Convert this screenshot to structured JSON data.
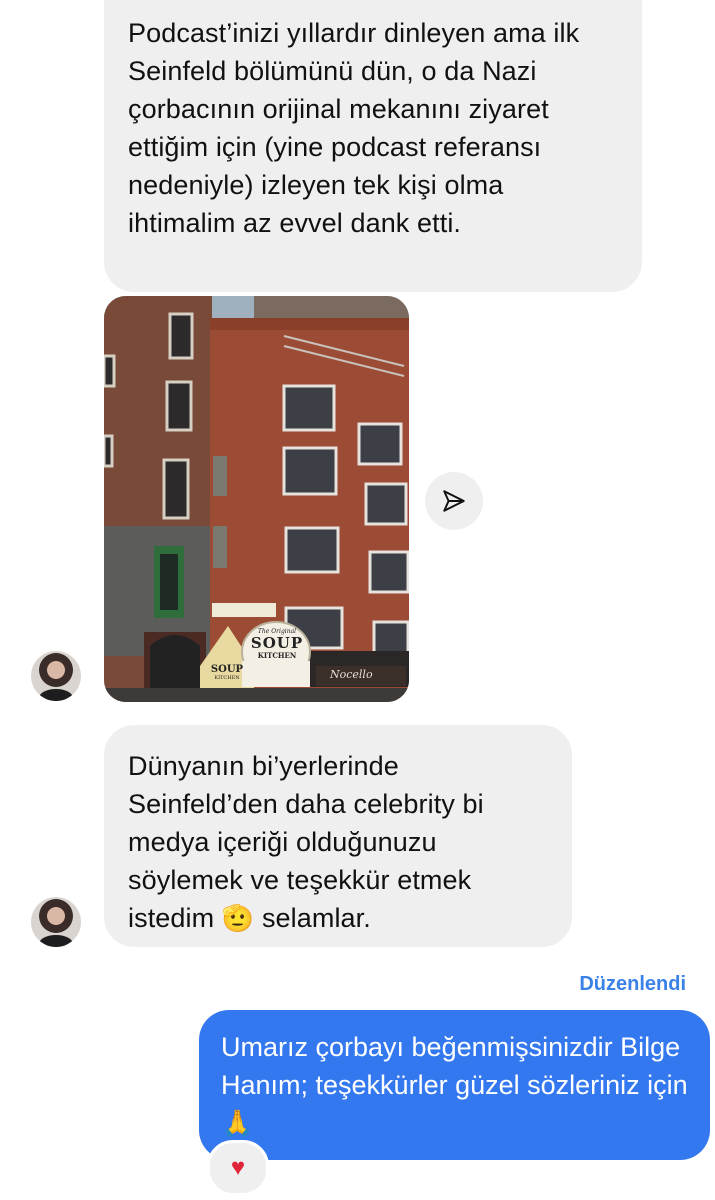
{
  "messages": {
    "incoming_1": {
      "text": "Podcast’inizi yıllardır dinleyen ama ilk Seinfeld bölümünü dün, o da Nazi çorbacının orijinal mekanını ziyaret ettiğim için (yine podcast referansı nedeniyle) izleyen tek kişi olma ihtimalim az evvel dank etti."
    },
    "photo": {
      "sign_line1": "The Original",
      "sign_line2": "SOUP",
      "sign_line3": "KITCHEN",
      "small_sign": "SOUP",
      "small_sign_sub": "KITCHEN",
      "store_name": "Nocello"
    },
    "incoming_2": {
      "text_main": "Dünyanın bi’yerlerinde Seinfeld’den daha celebrity bi medya içeriği olduğunuzu söylemek ve teşekkür etmek istedim",
      "emoji": "🫡",
      "text_end": "selamlar."
    },
    "edited_label": "Düzenlendi",
    "outgoing_1": {
      "text": "Umarız çorbayı beğenmişsinizdir Bilge Hanım; teşekkürler  güzel sözleriniz için",
      "emoji": "🙏"
    },
    "reaction": "♥"
  },
  "icons": {
    "share": "paper-plane-icon",
    "avatar": "user-avatar"
  },
  "colors": {
    "incoming_bubble": "#efeff0",
    "outgoing_bubble": "#3478f0",
    "edited_label": "#3a82e8"
  }
}
